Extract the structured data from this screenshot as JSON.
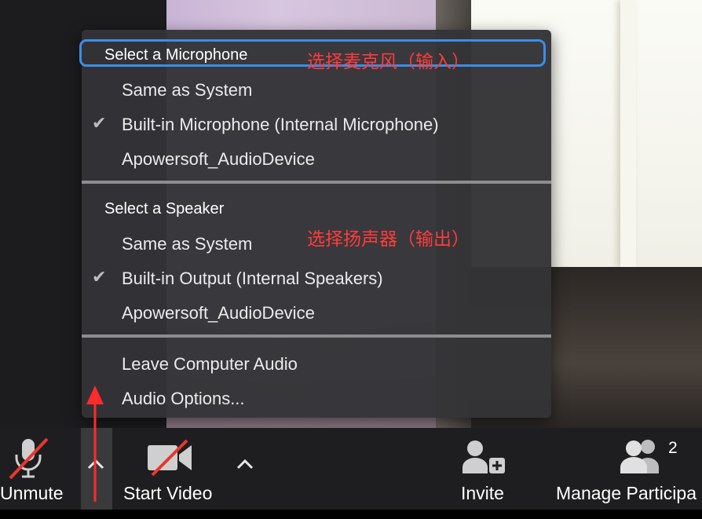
{
  "menu": {
    "microphone_header": "Select a Microphone",
    "microphone_items": [
      {
        "label": "Same as System",
        "checked": false
      },
      {
        "label": "Built-in Microphone (Internal Microphone)",
        "checked": true
      },
      {
        "label": "Apowersoft_AudioDevice",
        "checked": false
      }
    ],
    "speaker_header": "Select a Speaker",
    "speaker_items": [
      {
        "label": "Same as System",
        "checked": false
      },
      {
        "label": "Built-in Output (Internal Speakers)",
        "checked": true
      },
      {
        "label": "Apowersoft_AudioDevice",
        "checked": false
      }
    ],
    "leave_audio": "Leave Computer Audio",
    "audio_options": "Audio Options...",
    "check_glyph": "✔"
  },
  "annotations": {
    "mic": "选择麦克风（输入）",
    "speaker": "选择扬声器（输出）",
    "color": "#ff3b3b"
  },
  "toolbar": {
    "unmute_label": "Unmute",
    "start_video_label": "Start Video",
    "invite_label": "Invite",
    "participants_label": "Manage Participa",
    "participants_count": "2"
  },
  "colors": {
    "accent_blue": "#3a8ee8",
    "mute_slash_red": "#e8372f",
    "menu_bg": "#343437"
  }
}
